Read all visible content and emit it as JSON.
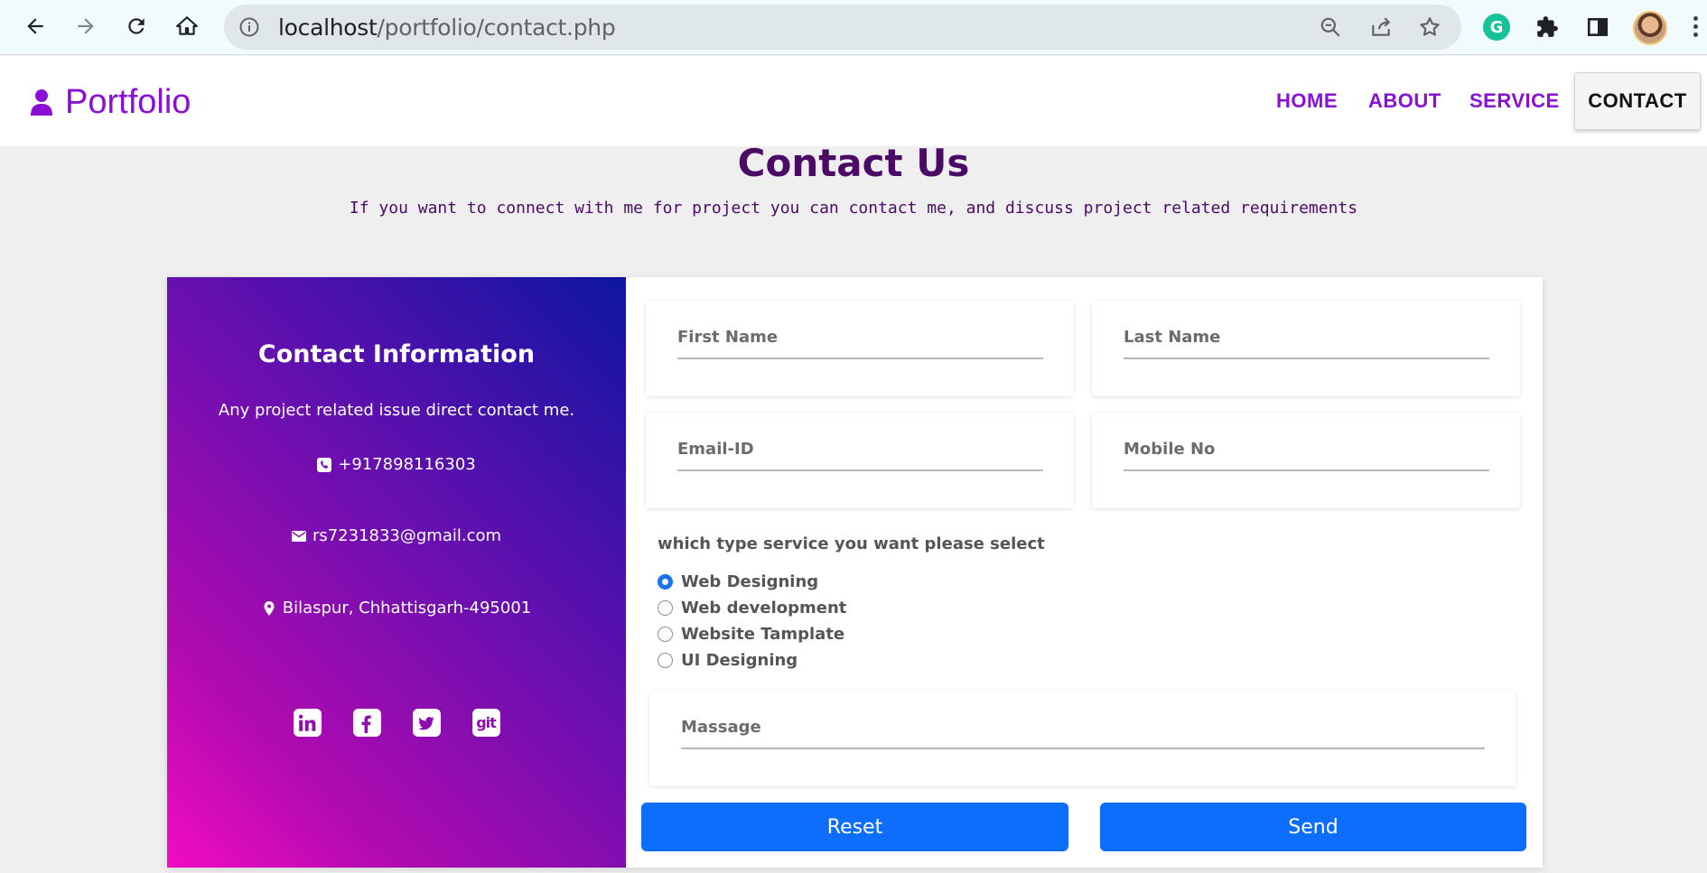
{
  "browser": {
    "url_host": "localhost",
    "url_path": "/portfolio/contact.php"
  },
  "site": {
    "brand": "Portfolio",
    "nav": [
      "HOME",
      "ABOUT",
      "SERVICE",
      "CONTACT"
    ]
  },
  "heading": {
    "title": "Contact Us",
    "subtitle": "If you want to connect with me for project you can contact me, and discuss project related requirements"
  },
  "contact_info": {
    "title": "Contact Information",
    "description": "Any project related issue direct contact me.",
    "phone": "+917898116303",
    "email": "rs7231833@gmail.com",
    "address": "Bilaspur, Chhattisgarh-495001",
    "social_icons": [
      "linkedin-icon",
      "facebook-icon",
      "twitter-icon",
      "git-icon"
    ],
    "git_label": "git"
  },
  "form": {
    "first_name_placeholder": "First Name",
    "last_name_placeholder": "Last Name",
    "email_placeholder": "Email-ID",
    "mobile_placeholder": "Mobile No",
    "service_label": "which type service you want please select",
    "services": [
      "Web Designing",
      "Web development",
      "Website Tamplate",
      "UI Designing"
    ],
    "selected_service": "Web Designing",
    "message_placeholder": "Massage",
    "reset_label": "Reset",
    "send_label": "Send"
  },
  "colors": {
    "brand": "#8a0fd6",
    "heading": "#4b0a66",
    "button": "#0d6efd"
  }
}
